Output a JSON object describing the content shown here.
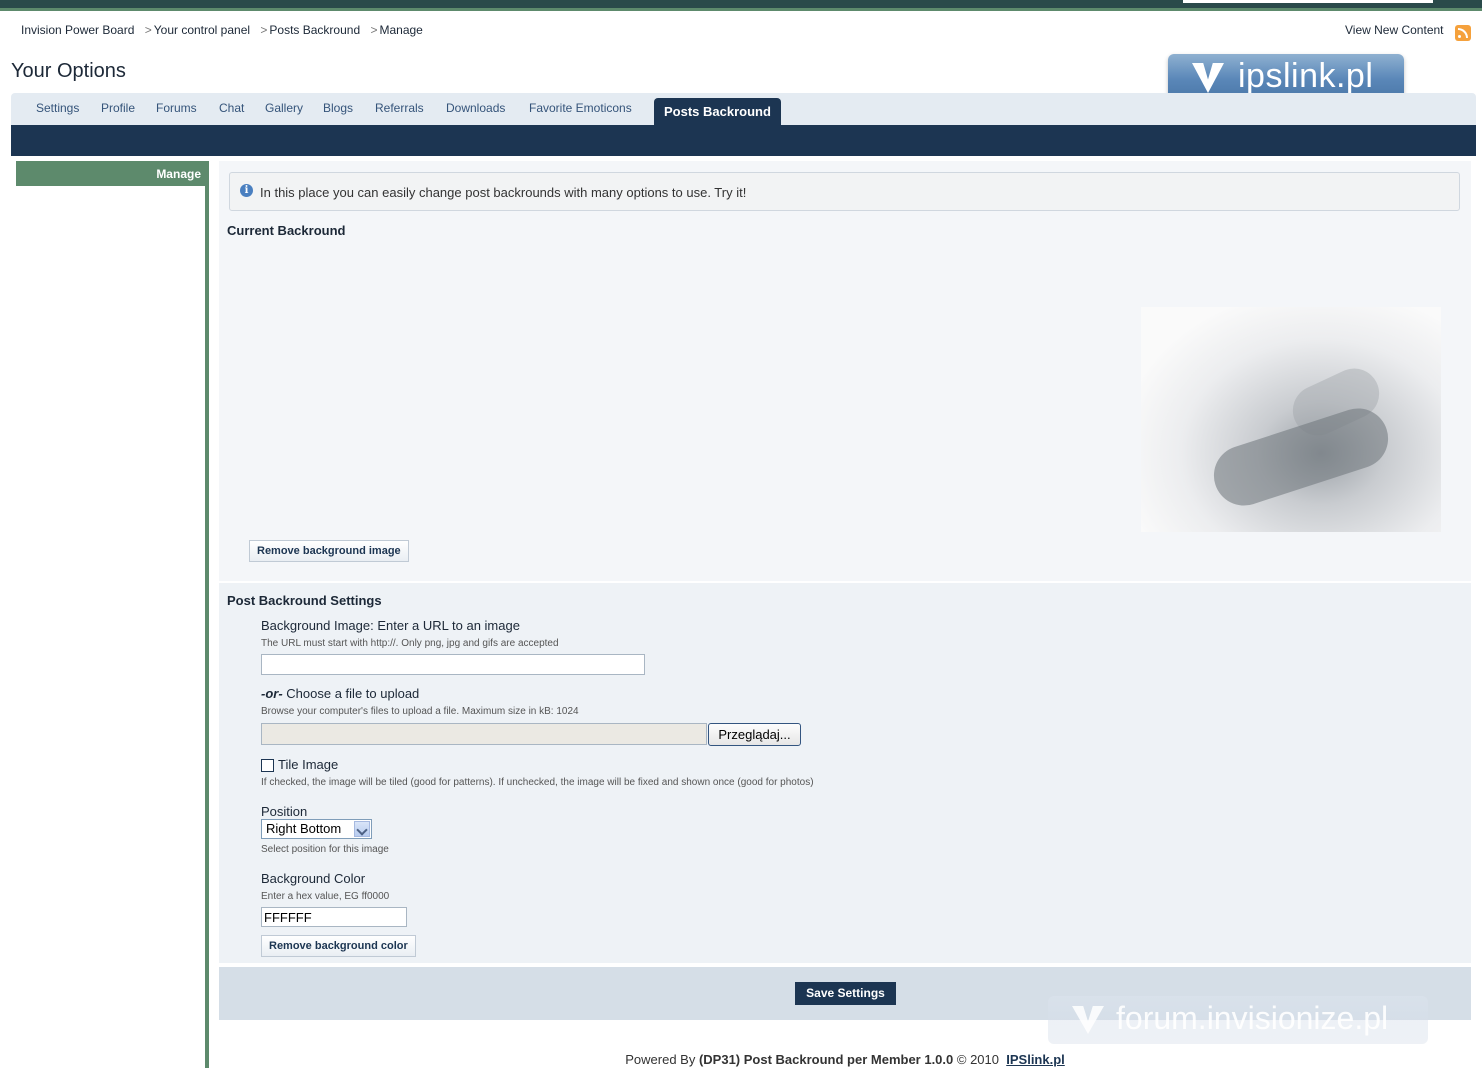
{
  "breadcrumb": [
    "Invision Power Board",
    "Your control panel",
    "Posts Backround",
    "Manage"
  ],
  "breadcrumb_separator": ">",
  "header": {
    "view_new_content": "View New Content",
    "rss_icon": "rss-icon",
    "logo_text": "ipslink.pl"
  },
  "page_title": "Your Options",
  "tabs": [
    "Settings",
    "Profile",
    "Forums",
    "Chat",
    "Gallery",
    "Blogs",
    "Referrals",
    "Downloads",
    "Favorite Emoticons",
    "Posts Backround"
  ],
  "active_tab": "Posts Backround",
  "sidebar": {
    "items": [
      "Manage"
    ]
  },
  "info_icon": "info-icon",
  "info_message": "In this place you can easily change post backrounds with many options to use. Try it!",
  "current": {
    "title": "Current Backround",
    "remove_image_label": "Remove background image"
  },
  "settings": {
    "title": "Post Backround Settings",
    "image_url_label": "Background Image: Enter a URL to an image",
    "image_url_desc": "The URL must start with http://. Only png, jpg and gifs are accepted",
    "image_url_value": "",
    "or_label": "-or-",
    "upload_label": "Choose a file to upload",
    "upload_desc": "Browse your computer's files to upload a file. Maximum size in kB: 1024",
    "browse_label": "Przeglądaj...",
    "tile_label": "Tile Image",
    "tile_checked": false,
    "tile_desc": "If checked, the image will be tiled (good for patterns). If unchecked, the image will be fixed and shown once (good for photos)",
    "position_label": "Position",
    "position_value": "Right Bottom",
    "position_desc": "Select position for this image",
    "color_label": "Background Color",
    "color_desc": "Enter a hex value, EG ff0000",
    "color_value": "FFFFFF",
    "remove_color_label": "Remove background color"
  },
  "save_label": "Save Settings",
  "watermark_text": "forum.invisionize.pl",
  "footer": {
    "prefix": "Powered By",
    "product": "(DP31) Post Backround per Member 1.0.0",
    "copyright": "© 2010",
    "link": "IPSlink.pl"
  },
  "colors": {
    "navy": "#1c3552",
    "green": "#5d8a6c",
    "tab_bg": "#e4ebf2"
  }
}
